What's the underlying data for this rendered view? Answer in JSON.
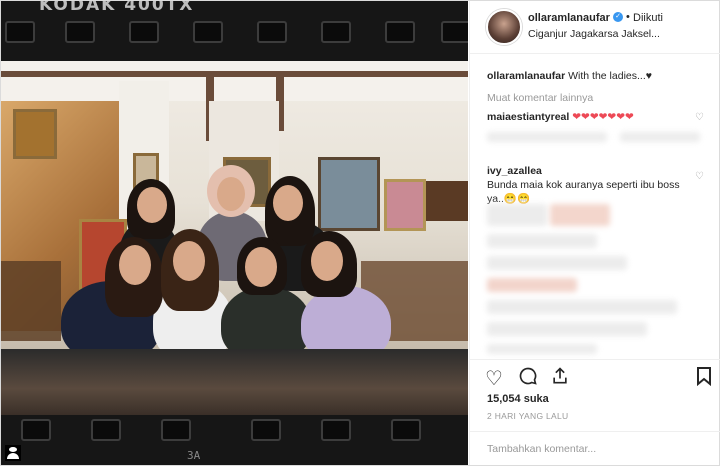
{
  "photo": {
    "film_brand": "KODAK 400TX",
    "frame_label": "3A"
  },
  "header": {
    "username": "ollaramlanaufar",
    "separator": "•",
    "follow_label": "Diikuti",
    "location": "Ciganjur Jagakarsa Jaksel..."
  },
  "comments": {
    "caption_user": "ollaramlanaufar",
    "caption_text": "With the ladies...♥",
    "load_more": "Muat komentar lainnya",
    "items": [
      {
        "user": "maiaestiantyreal",
        "text": "❤❤❤❤❤❤❤"
      },
      {
        "user": "ivy_azallea",
        "text": "Bunda maia kok auranya seperti ibu boss ya..😁😁"
      }
    ]
  },
  "actions": {
    "likes": "15,054 suka",
    "time": "2 HARI YANG LALU"
  },
  "add_comment": {
    "placeholder": "Tambahkan komentar..."
  },
  "icons": [
    "heart-icon",
    "comment-icon",
    "share-icon",
    "bookmark-icon",
    "verified-badge-icon",
    "user-tag-icon"
  ],
  "colors": {
    "verified": "#3897f0",
    "heart": "#ed4956",
    "muted": "#999999"
  }
}
